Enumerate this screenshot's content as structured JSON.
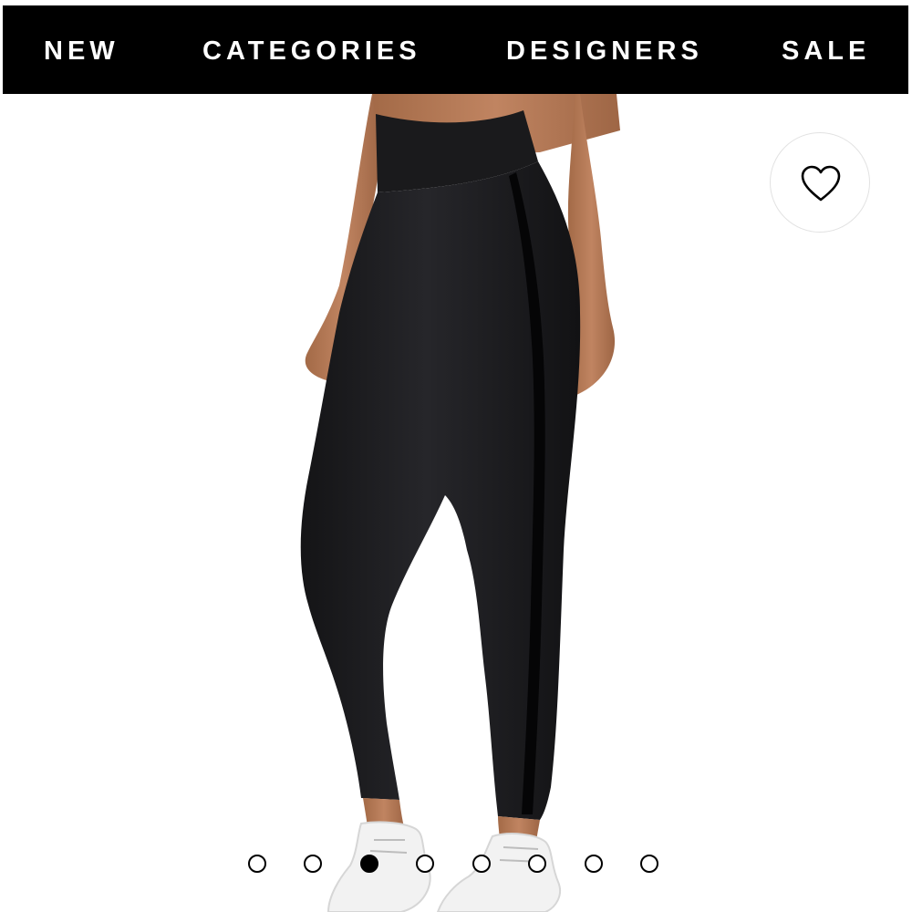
{
  "nav": {
    "items": [
      {
        "label": "NEW"
      },
      {
        "label": "CATEGORIES"
      },
      {
        "label": "DESIGNERS"
      },
      {
        "label": "SALE"
      }
    ]
  },
  "product_image": {
    "subject": "black high-waisted leggings with side stripe, white sneakers"
  },
  "wishlist": {
    "icon": "heart-outline-icon"
  },
  "carousel": {
    "total_slides": 8,
    "active_index": 3
  },
  "colors": {
    "nav_background": "#000000",
    "nav_text": "#ffffff",
    "leggings": "#1c1c1e",
    "skin": "#b37853",
    "sneakers": "#f3f3f3"
  }
}
